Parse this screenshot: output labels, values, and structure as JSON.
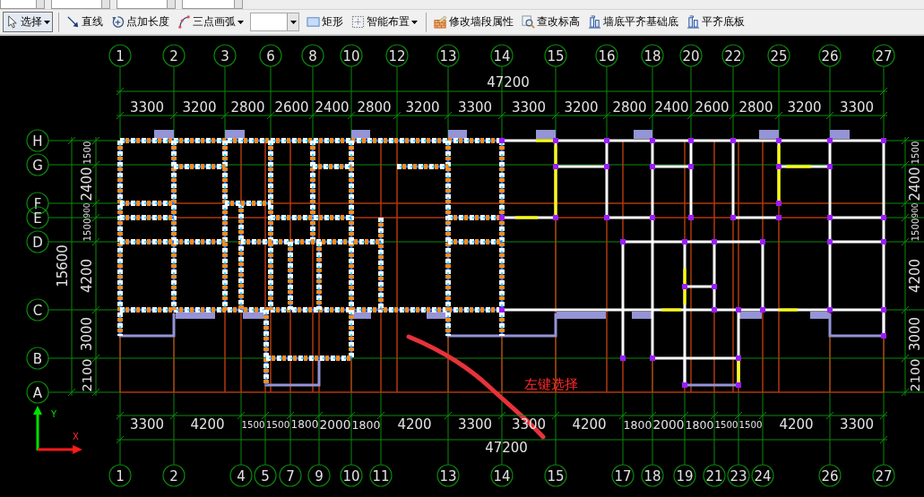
{
  "top_strip": {
    "fields": [
      {
        "kind": "combo"
      },
      {
        "kind": "combo"
      },
      {
        "kind": "combo"
      },
      {
        "kind": "combo"
      }
    ]
  },
  "toolbar": {
    "items": [
      {
        "kind": "tool",
        "label": "选择",
        "dropdown": true,
        "selected": true
      },
      {
        "kind": "separator"
      },
      {
        "kind": "tool",
        "label": "直线",
        "dropdown": false,
        "selected": false
      },
      {
        "kind": "tool",
        "label": "点加长度",
        "dropdown": false,
        "selected": false
      },
      {
        "kind": "tool",
        "label": "三点画弧",
        "dropdown": true,
        "selected": false
      },
      {
        "kind": "combo"
      },
      {
        "kind": "tool",
        "label": "矩形",
        "dropdown": false,
        "selected": false
      },
      {
        "kind": "tool",
        "label": "智能布置",
        "dropdown": true,
        "selected": false
      },
      {
        "kind": "separator"
      },
      {
        "kind": "tool",
        "label": "修改墙段属性",
        "dropdown": false,
        "selected": false
      },
      {
        "kind": "tool",
        "label": "查改标高",
        "dropdown": false,
        "selected": false
      },
      {
        "kind": "tool",
        "label": "墙底平齐基础底",
        "dropdown": false,
        "selected": false
      },
      {
        "kind": "tool",
        "label": "平齐底板",
        "dropdown": false,
        "selected": false
      }
    ]
  },
  "canvas": {
    "top_axes": [
      "1",
      "2",
      "3",
      "6",
      "8",
      "10",
      "12",
      "13",
      "14",
      "15",
      "16",
      "18",
      "20",
      "22",
      "25",
      "26",
      "27"
    ],
    "top_total": "47200",
    "top_spans": [
      "3300",
      "3200",
      "2800",
      "2600",
      "2400",
      "2800",
      "3200",
      "3300",
      "3300",
      "3200",
      "2800",
      "2400",
      "2600",
      "2800",
      "3200",
      "3300"
    ],
    "left_axes": [
      "H",
      "G",
      "F",
      "E",
      "D",
      "C",
      "B",
      "A"
    ],
    "left_total": "15600",
    "left_spans": [
      "1500",
      "2400",
      "900",
      "1500",
      "4200",
      "3000",
      "2100"
    ],
    "right_spans": [
      "1500",
      "2400",
      "900",
      "1500",
      "4200",
      "3000",
      "2100"
    ],
    "annotation": {
      "text": "左键选择"
    },
    "axis_indicator": {
      "y_label": "Y",
      "x_label": "X"
    },
    "bottom_spans": [
      "3300",
      "4200",
      "1500",
      "1500",
      "1800",
      "2000",
      "1800",
      "4200",
      "3300",
      "3300",
      "4200",
      "1800",
      "2000",
      "1800",
      "1500",
      "1500",
      "4200",
      "3300"
    ],
    "bottom_total": "47200",
    "bottom_axes": [
      "1",
      "2",
      "4",
      "5",
      "7",
      "9",
      "10",
      "11",
      "13",
      "14",
      "15",
      "17",
      "18",
      "19",
      "21",
      "23",
      "24",
      "26",
      "27"
    ]
  }
}
